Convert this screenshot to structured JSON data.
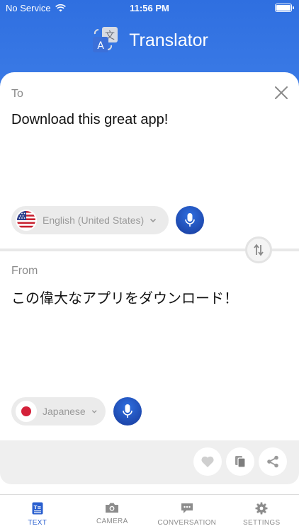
{
  "status_bar": {
    "carrier": "No Service",
    "time": "11:56 PM"
  },
  "app": {
    "title": "Translator"
  },
  "target": {
    "label": "To",
    "text": "Download this great app!",
    "language": "English (United States)"
  },
  "source": {
    "label": "From",
    "text": "この偉大なアプリをダウンロード！",
    "language": "Japanese"
  },
  "tabs": [
    {
      "label": "TEXT",
      "icon": "text-icon",
      "active": true
    },
    {
      "label": "CAMERA",
      "icon": "camera-icon",
      "active": false
    },
    {
      "label": "CONVERSATION",
      "icon": "conversation-icon",
      "active": false
    },
    {
      "label": "SETTINGS",
      "icon": "gear-icon",
      "active": false
    }
  ],
  "colors": {
    "brand": "#2f6fe0",
    "mic": "#17399a",
    "active_tab": "#2a5fcf"
  }
}
